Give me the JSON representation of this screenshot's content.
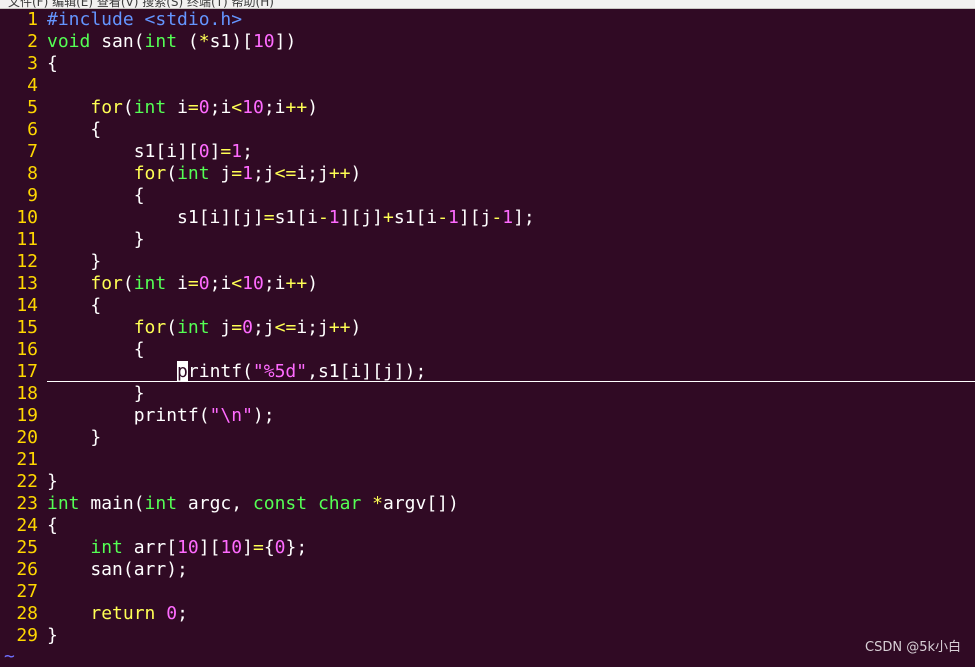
{
  "menubar": {
    "text": "文件(F)  编辑(E)  查看(V)  搜索(S)  终端(T)  帮助(H)"
  },
  "editor": {
    "lines": [
      {
        "n": "1",
        "html": "<span class=\"pp\">#include &lt;stdio.h&gt;</span>"
      },
      {
        "n": "2",
        "html": "<span class=\"type\">void</span> san(<span class=\"type\">int</span> (<span class=\"op\">*</span>s1)[<span class=\"num\">10</span>])"
      },
      {
        "n": "3",
        "html": "{"
      },
      {
        "n": "4",
        "html": ""
      },
      {
        "n": "5",
        "html": "    <span class=\"kw\">for</span>(<span class=\"type\">int</span> i<span class=\"op\">=</span><span class=\"num\">0</span>;i<span class=\"op\">&lt;</span><span class=\"num\">10</span>;i<span class=\"op\">++</span>)"
      },
      {
        "n": "6",
        "html": "    {"
      },
      {
        "n": "7",
        "html": "        s1[i][<span class=\"num\">0</span>]<span class=\"op\">=</span><span class=\"num\">1</span>;"
      },
      {
        "n": "8",
        "html": "        <span class=\"kw\">for</span>(<span class=\"type\">int</span> j<span class=\"op\">=</span><span class=\"num\">1</span>;j<span class=\"op\">&lt;=</span>i;j<span class=\"op\">++</span>)"
      },
      {
        "n": "9",
        "html": "        {"
      },
      {
        "n": "10",
        "html": "            s1[i][j]<span class=\"op\">=</span>s1[i<span class=\"op\">-</span><span class=\"num\">1</span>][j]<span class=\"op\">+</span>s1[i<span class=\"op\">-</span><span class=\"num\">1</span>][j<span class=\"op\">-</span><span class=\"num\">1</span>];"
      },
      {
        "n": "11",
        "html": "        }"
      },
      {
        "n": "12",
        "html": "    }"
      },
      {
        "n": "13",
        "html": "    <span class=\"kw\">for</span>(<span class=\"type\">int</span> i<span class=\"op\">=</span><span class=\"num\">0</span>;i<span class=\"op\">&lt;</span><span class=\"num\">10</span>;i<span class=\"op\">++</span>)"
      },
      {
        "n": "14",
        "html": "    {"
      },
      {
        "n": "15",
        "html": "        <span class=\"kw\">for</span>(<span class=\"type\">int</span> j<span class=\"op\">=</span><span class=\"num\">0</span>;j<span class=\"op\">&lt;=</span>i;j<span class=\"op\">++</span>)"
      },
      {
        "n": "16",
        "html": "        {"
      },
      {
        "n": "17",
        "html": "            <span class=\"cursor\">p</span>rintf(<span class=\"str\">\"%5d\"</span>,s1[i][j]);",
        "cursorline": true
      },
      {
        "n": "18",
        "html": "        }"
      },
      {
        "n": "19",
        "html": "        printf(<span class=\"str\">\"\\n\"</span>);"
      },
      {
        "n": "20",
        "html": "    }"
      },
      {
        "n": "21",
        "html": ""
      },
      {
        "n": "22",
        "html": "}"
      },
      {
        "n": "23",
        "html": "<span class=\"type\">int</span> main(<span class=\"type\">int</span> argc, <span class=\"type\">const</span> <span class=\"type\">char</span> <span class=\"op\">*</span>argv[])"
      },
      {
        "n": "24",
        "html": "{"
      },
      {
        "n": "25",
        "html": "    <span class=\"type\">int</span> arr[<span class=\"num\">10</span>][<span class=\"num\">10</span>]<span class=\"op\">=</span>{<span class=\"num\">0</span>};"
      },
      {
        "n": "26",
        "html": "    san(arr);"
      },
      {
        "n": "27",
        "html": ""
      },
      {
        "n": "28",
        "html": "    <span class=\"kw\">return</span> <span class=\"num\">0</span>;"
      },
      {
        "n": "29",
        "html": "}"
      }
    ],
    "tilde": "~"
  },
  "watermark": "CSDN @5k小白",
  "colors": {
    "background": "#300a24",
    "line_number": "#ffd700",
    "keyword": "#ffff54",
    "type": "#54ff54",
    "preprocessor": "#6495ff",
    "constant": "#ff6bff"
  }
}
